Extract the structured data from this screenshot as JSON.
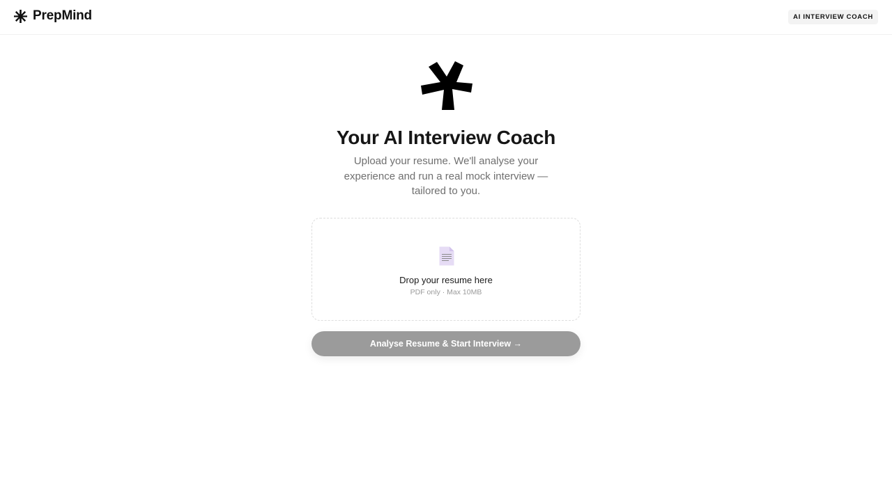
{
  "header": {
    "brand_name": "PrepMind",
    "badge": "AI INTERVIEW COACH"
  },
  "hero": {
    "title": "Your AI Interview Coach",
    "subtitle": "Upload your resume. We'll analyse your experience and run a real mock interview — tailored to you."
  },
  "upload": {
    "title": "Drop your resume here",
    "hint": "PDF only · Max 10MB",
    "icon": "document-icon"
  },
  "cta": {
    "label": "Analyse Resume & Start Interview →"
  },
  "colors": {
    "brand": "#111111",
    "button_disabled": "#9b9b9b",
    "doc_icon": "#e6dcf5"
  }
}
